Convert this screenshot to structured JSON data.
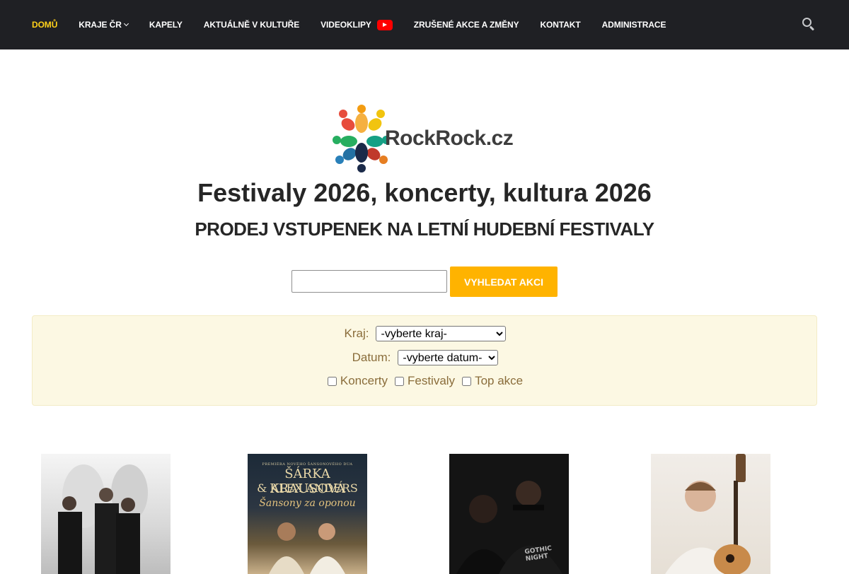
{
  "nav": {
    "items": [
      {
        "label": "DOMŮ",
        "active": true
      },
      {
        "label": "KRAJE ČR",
        "dropdown": true
      },
      {
        "label": "KAPELY"
      },
      {
        "label": "AKTUÁLNĚ V KULTUŘE"
      },
      {
        "label": "VIDEOKLIPY",
        "icon": "youtube-icon"
      },
      {
        "label": "ZRUŠENÉ AKCE A ZMĚNY"
      },
      {
        "label": "KONTAKT"
      },
      {
        "label": "ADMINISTRACE"
      }
    ],
    "search_icon": "search-icon",
    "active_color": "#ffd11a",
    "background": "#1f2024"
  },
  "logo": {
    "text": "RockRock.cz"
  },
  "heading": {
    "title": "Festivaly 2026, koncerty, kultura 2026",
    "subtitle": "PRODEJ VSTUPENEK NA LETNÍ HUDEBNÍ FESTIVALY"
  },
  "search": {
    "value": "",
    "button_label": "VYHLEDAT AKCI",
    "button_color": "#ffb300"
  },
  "filter": {
    "kraj_label": "Kraj:",
    "kraj_selected": "-vyberte kraj-",
    "datum_label": "Datum:",
    "datum_selected": "-vyberte datum-",
    "checkboxes": [
      {
        "label": "Koncerty",
        "checked": false
      },
      {
        "label": "Festivaly",
        "checked": false
      },
      {
        "label": "Top akce",
        "checked": false
      }
    ]
  },
  "posters": [
    {
      "alt": "band-photo"
    },
    {
      "line1": "PREMIÉRA NOVÉHO ŠANSONOVÉHO DUA",
      "line2": "ŠÁRKA KRAUSOVÁ",
      "line3": "& ALEX ANDERS",
      "line4": "Šansony za oponou"
    },
    {
      "tshirt_text": "GOTHIC NIGHT"
    },
    {
      "alt": "guitarist-photo"
    }
  ]
}
